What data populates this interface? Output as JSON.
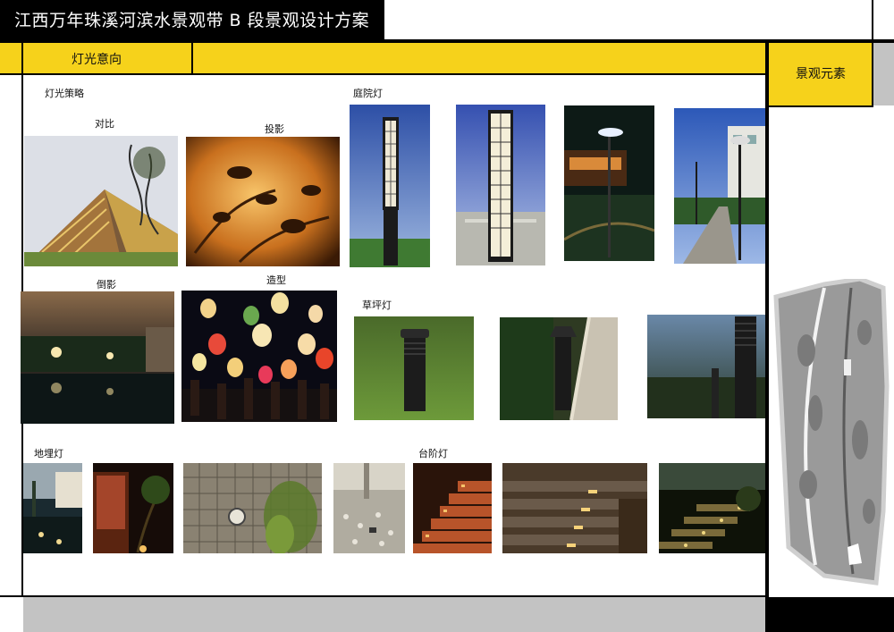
{
  "title": "江西万年珠溪河滨水景观带 B 段景观设计方案",
  "header": {
    "section_title": "灯光意向",
    "side_title": "景观元素"
  },
  "groups": {
    "strategy": "灯光策略",
    "courtyard": "庭院灯",
    "lawn": "草坪灯",
    "inground": "地埋灯",
    "step": "台阶灯"
  },
  "captions": {
    "contrast": "对比",
    "projection": "投影",
    "reflection": "倒影",
    "shaping": "造型"
  },
  "colors": {
    "accent_yellow": "#f6d21b",
    "frame_black": "#000000",
    "footer_gray": "#c3c3c3"
  },
  "icons": {
    "site_plan": "site-plan-map"
  }
}
